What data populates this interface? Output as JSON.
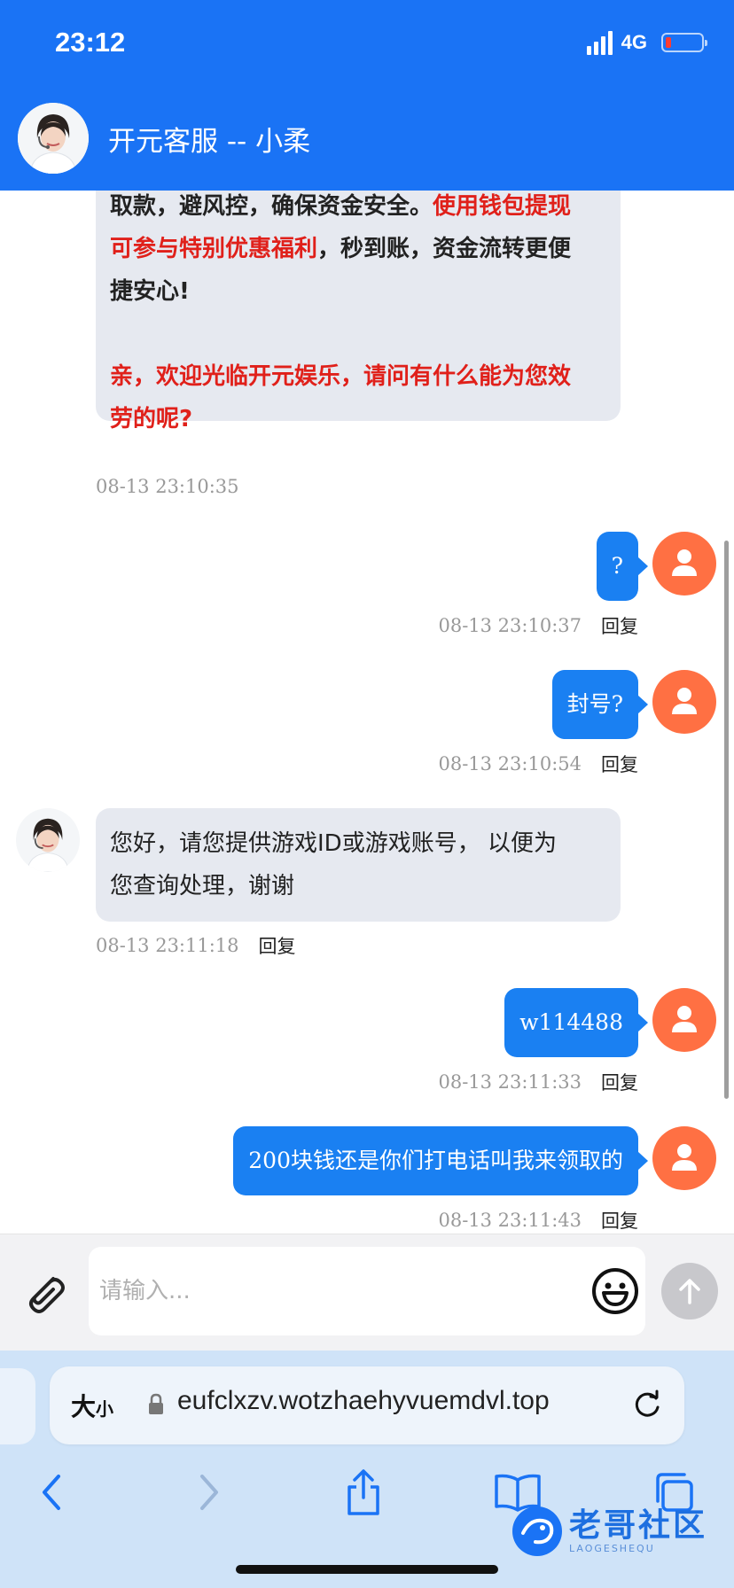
{
  "status_bar": {
    "time": "23:12",
    "network": "4G"
  },
  "header": {
    "title": "开元客服 -- 小柔"
  },
  "messages": {
    "m1": {
      "line1_pre": "取款，避风控，确保资金安全。",
      "line1_red": "使用钱包提现",
      "line2_red": "可参与特别优惠福利",
      "line2_post": "，秒到账，资金流转更便",
      "line3": "捷安心!",
      "line4_red": "亲，欢迎光临开元娱乐，请问有什么能为您效",
      "line5_red": "劳的呢?",
      "time": "08-13 23:10:35"
    },
    "m2": {
      "text": "?",
      "time": "08-13 23:10:37",
      "reply": "回复"
    },
    "m3": {
      "text": "封号?",
      "time": "08-13 23:10:54",
      "reply": "回复"
    },
    "m4": {
      "line1": "您好，请您提供游戏ID或游戏账号， 以便为",
      "line2": "您查询处理，谢谢",
      "time": "08-13 23:11:18",
      "reply": "回复"
    },
    "m5": {
      "text": "w114488",
      "time": "08-13 23:11:33",
      "reply": "回复"
    },
    "m6": {
      "text": "200块钱还是你们打电话叫我来领取的",
      "time": "08-13 23:11:43",
      "reply": "回复"
    }
  },
  "composer": {
    "placeholder": "请输入..."
  },
  "browser": {
    "text_size_big": "大",
    "text_size_small": "小",
    "url": "eufclxzv.wotzhaehyvuemdvl.top"
  },
  "watermark": {
    "title": "老哥社区",
    "subtitle": "LAOGESHEQU"
  },
  "colors": {
    "header_blue": "#1a73f5",
    "bubble_out": "#1a80f2",
    "bubble_in": "#e6e9f0",
    "accent_red": "#e0201a",
    "user_avatar": "#ff7043"
  }
}
